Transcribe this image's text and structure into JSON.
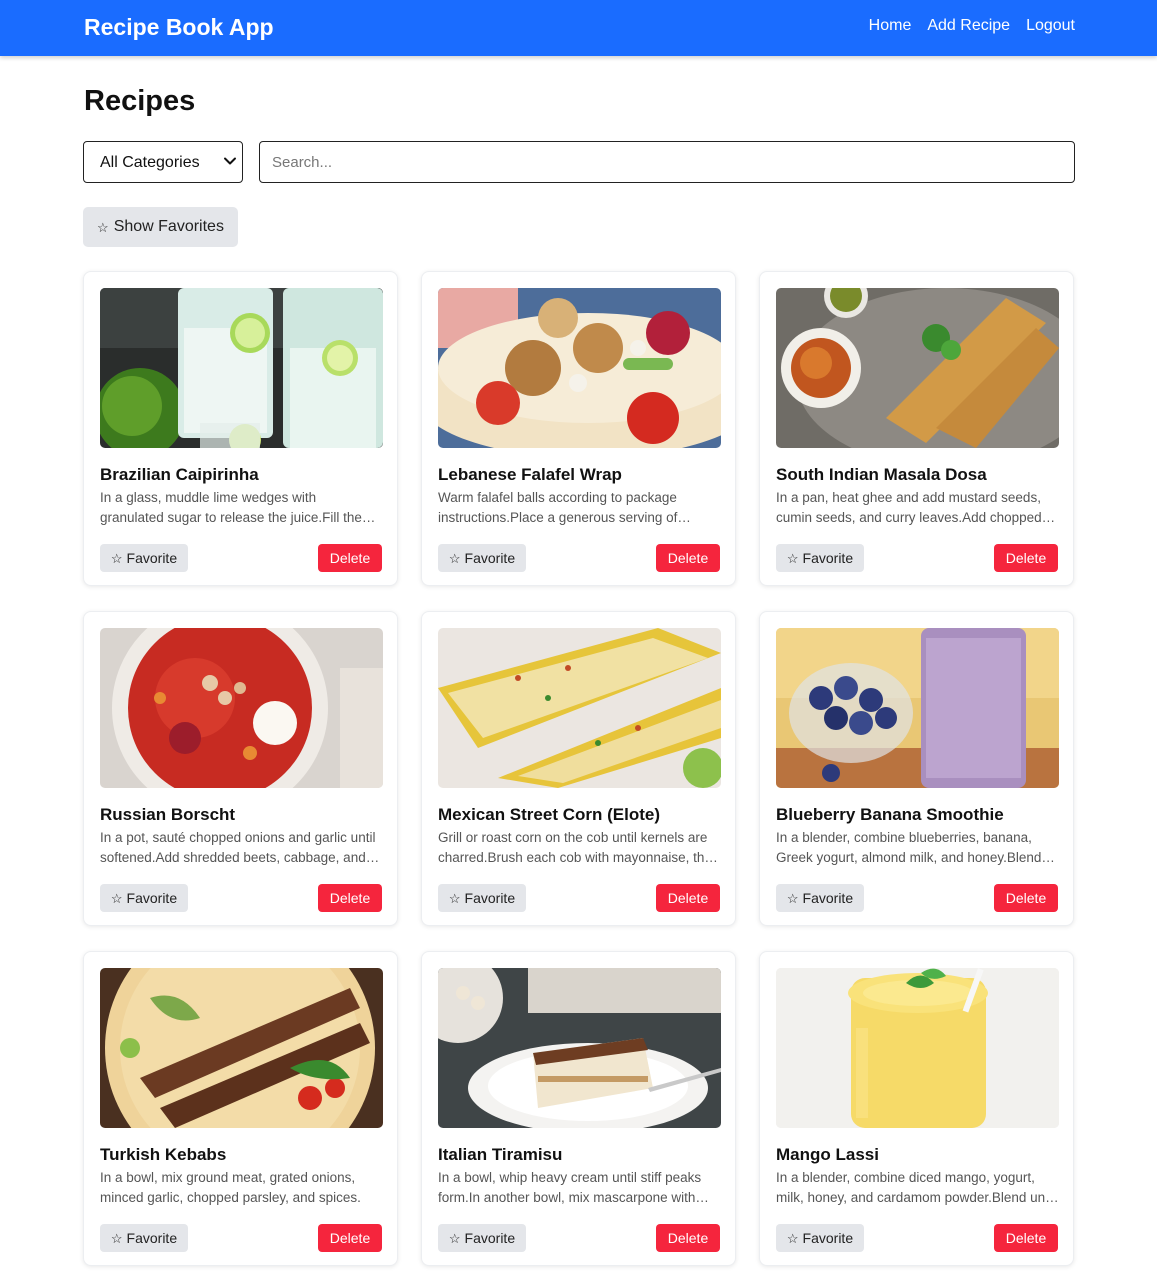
{
  "header": {
    "brand": "Recipe Book App",
    "links": [
      "Home",
      "Add Recipe",
      "Logout"
    ],
    "bg_color": "#1a6cff"
  },
  "page": {
    "title": "Recipes"
  },
  "filters": {
    "category_selected": "All Categories",
    "search_placeholder": "Search...",
    "favorites_toggle_icon": "☆",
    "favorites_toggle_label": "Show Favorites"
  },
  "card_actions": {
    "favorite_icon": "☆",
    "favorite_label": "Favorite",
    "delete_label": "Delete",
    "delete_color": "#f5253d"
  },
  "recipes": [
    {
      "title": "Brazilian Caipirinha",
      "description": "In a glass, muddle lime wedges with granulated sugar to release the juice.Fill the glass with crushed ice and pour in cachaça.",
      "image": "caipirinha-photo"
    },
    {
      "title": "Lebanese Falafel Wrap",
      "description": "Warm falafel balls according to package instructions.Place a generous serving of hummus on a pita.",
      "image": "falafel-wrap-photo"
    },
    {
      "title": "South Indian Masala Dosa",
      "description": "In a pan, heat ghee and add mustard seeds, cumin seeds, and curry leaves.Add chopped onions and potatoes.",
      "image": "masala-dosa-photo"
    },
    {
      "title": "Russian Borscht",
      "description": "In a pot, sauté chopped onions and garlic until softened.Add shredded beets, cabbage, and carrots.",
      "image": "borscht-photo"
    },
    {
      "title": "Mexican Street Corn (Elote)",
      "description": "Grill or roast corn on the cob until kernels are charred.Brush each cob with mayonnaise, then sprinkle cheese.",
      "image": "elote-photo"
    },
    {
      "title": "Blueberry Banana Smoothie",
      "description": "In a blender, combine blueberries, banana, Greek yogurt, almond milk, and honey.Blend until smooth.",
      "image": "smoothie-photo"
    },
    {
      "title": "Turkish Kebabs",
      "description": "In a bowl, mix ground meat, grated onions, minced garlic, chopped parsley, and spices.",
      "image": "kebabs-photo"
    },
    {
      "title": "Italian Tiramisu",
      "description": "In a bowl, whip heavy cream until stiff peaks form.In another bowl, mix mascarpone with sugar.",
      "image": "tiramisu-photo"
    },
    {
      "title": "Mango Lassi",
      "description": "In a blender, combine diced mango, yogurt, milk, honey, and cardamom powder.Blend until smooth.",
      "image": "mango-lassi-photo"
    }
  ]
}
